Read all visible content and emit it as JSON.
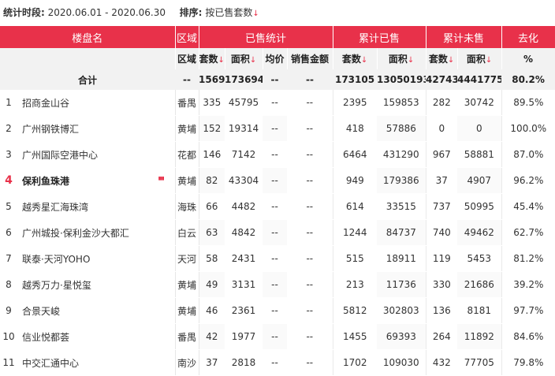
{
  "filter": {
    "period_label": "统计时段:",
    "period_value": "2020.06.01 - 2020.06.30",
    "sort_label": "排序:",
    "sort_value": "按已售套数",
    "sort_icon": "arrow-down-icon"
  },
  "headers": {
    "project": "楼盘名",
    "district": "区域",
    "sold_group": "已售统计",
    "cum_sold_group": "累计已售",
    "cum_unsold_group": "累计未售",
    "absorption_group": "去化",
    "sub": {
      "district": "区域",
      "units": "套数",
      "area": "面积",
      "avg_price": "均价",
      "sales_amount": "销售金额",
      "cum_units": "套数",
      "cum_area": "面积",
      "unsold_units": "套数",
      "unsold_area": "面积",
      "rate": "%"
    }
  },
  "total": {
    "label": "合计",
    "district": "--",
    "units": "1569",
    "area": "173694",
    "avg_price": "--",
    "sales_amount": "--",
    "cum_units": "173105",
    "cum_area": "13050193",
    "unsold_units": "42743",
    "unsold_area": "4441775",
    "rate": "80.2%"
  },
  "rows": [
    {
      "rank": "1",
      "name": "招商金山谷",
      "district": "番禺",
      "units": "335",
      "area": "45795",
      "avg_price": "--",
      "sales_amount": "--",
      "cum_units": "2395",
      "cum_area": "159853",
      "unsold_units": "282",
      "unsold_area": "30742",
      "rate": "89.5%"
    },
    {
      "rank": "2",
      "name": "广州钢铁博汇",
      "district": "黄埔",
      "units": "152",
      "area": "19314",
      "avg_price": "--",
      "sales_amount": "--",
      "cum_units": "418",
      "cum_area": "57886",
      "unsold_units": "0",
      "unsold_area": "0",
      "rate": "100.0%"
    },
    {
      "rank": "3",
      "name": "广州国际空港中心",
      "district": "花都",
      "units": "146",
      "area": "7142",
      "avg_price": "--",
      "sales_amount": "--",
      "cum_units": "6464",
      "cum_area": "431290",
      "unsold_units": "967",
      "unsold_area": "58881",
      "rate": "87.0%"
    },
    {
      "rank": "4",
      "name": "保利鱼珠港",
      "district": "黄埔",
      "units": "82",
      "area": "43304",
      "avg_price": "--",
      "sales_amount": "--",
      "cum_units": "949",
      "cum_area": "179386",
      "unsold_units": "37",
      "unsold_area": "4907",
      "rate": "96.2%"
    },
    {
      "rank": "5",
      "name": "越秀星汇海珠湾",
      "district": "海珠",
      "units": "66",
      "area": "4482",
      "avg_price": "--",
      "sales_amount": "--",
      "cum_units": "614",
      "cum_area": "33515",
      "unsold_units": "737",
      "unsold_area": "50995",
      "rate": "45.4%"
    },
    {
      "rank": "6",
      "name": "广州城投·保利金沙大都汇",
      "district": "白云",
      "units": "63",
      "area": "4842",
      "avg_price": "--",
      "sales_amount": "--",
      "cum_units": "1244",
      "cum_area": "84737",
      "unsold_units": "740",
      "unsold_area": "49462",
      "rate": "62.7%"
    },
    {
      "rank": "7",
      "name": "联泰·天河YOHO",
      "district": "天河",
      "units": "58",
      "area": "2431",
      "avg_price": "--",
      "sales_amount": "--",
      "cum_units": "515",
      "cum_area": "18911",
      "unsold_units": "119",
      "unsold_area": "5453",
      "rate": "81.2%"
    },
    {
      "rank": "8",
      "name": "越秀万力·星悦玺",
      "district": "黄埔",
      "units": "49",
      "area": "3131",
      "avg_price": "--",
      "sales_amount": "--",
      "cum_units": "213",
      "cum_area": "11736",
      "unsold_units": "330",
      "unsold_area": "21686",
      "rate": "39.2%"
    },
    {
      "rank": "9",
      "name": "合景天峻",
      "district": "黄埔",
      "units": "46",
      "area": "2361",
      "avg_price": "--",
      "sales_amount": "--",
      "cum_units": "5812",
      "cum_area": "302803",
      "unsold_units": "136",
      "unsold_area": "8181",
      "rate": "97.7%"
    },
    {
      "rank": "10",
      "name": "信业悦都荟",
      "district": "番禺",
      "units": "42",
      "area": "1977",
      "avg_price": "--",
      "sales_amount": "--",
      "cum_units": "1455",
      "cum_area": "69393",
      "unsold_units": "264",
      "unsold_area": "11892",
      "rate": "84.6%"
    },
    {
      "rank": "11",
      "name": "中交汇通中心",
      "district": "南沙",
      "units": "37",
      "area": "2818",
      "avg_price": "--",
      "sales_amount": "--",
      "cum_units": "1702",
      "cum_area": "109030",
      "unsold_units": "432",
      "unsold_area": "77705",
      "rate": "79.8%"
    }
  ],
  "highlight_rank": "4",
  "colors": {
    "accent": "#e8314a",
    "header_gray": "#f2f2f2"
  }
}
